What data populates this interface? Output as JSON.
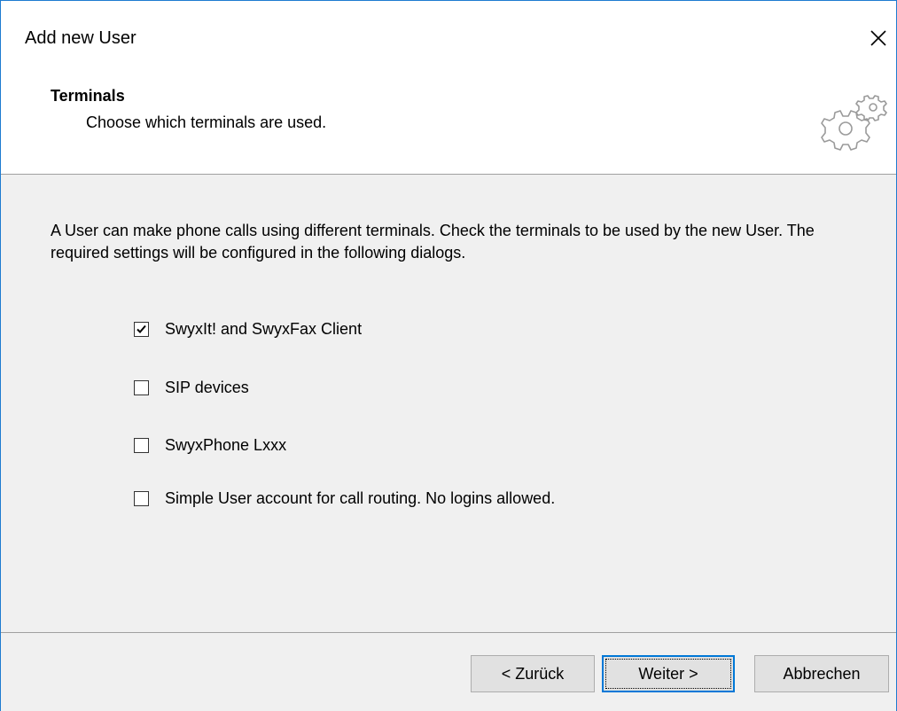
{
  "window": {
    "title": "Add new User"
  },
  "header": {
    "title": "Terminals",
    "subtitle": "Choose which terminals are used.",
    "icon": "gears-icon"
  },
  "content": {
    "description": "A User can make phone calls using different terminals. Check the terminals to be used by the new User. The required settings will be configured in the following dialogs.",
    "options": [
      {
        "label": "SwyxIt! and SwyxFax Client",
        "checked": true
      },
      {
        "label": "SIP devices",
        "checked": false
      },
      {
        "label": "SwyxPhone Lxxx",
        "checked": false
      },
      {
        "label": "Simple User account for call routing. No logins allowed.",
        "checked": false
      }
    ]
  },
  "buttons": {
    "back": "< Zurück",
    "next": "Weiter >",
    "cancel": "Abbrechen"
  },
  "colors": {
    "accent": "#0078d7",
    "window_border": "#1e7bd0",
    "dialog_bg": "#f0f0f0",
    "button_bg": "#e1e1e1"
  }
}
